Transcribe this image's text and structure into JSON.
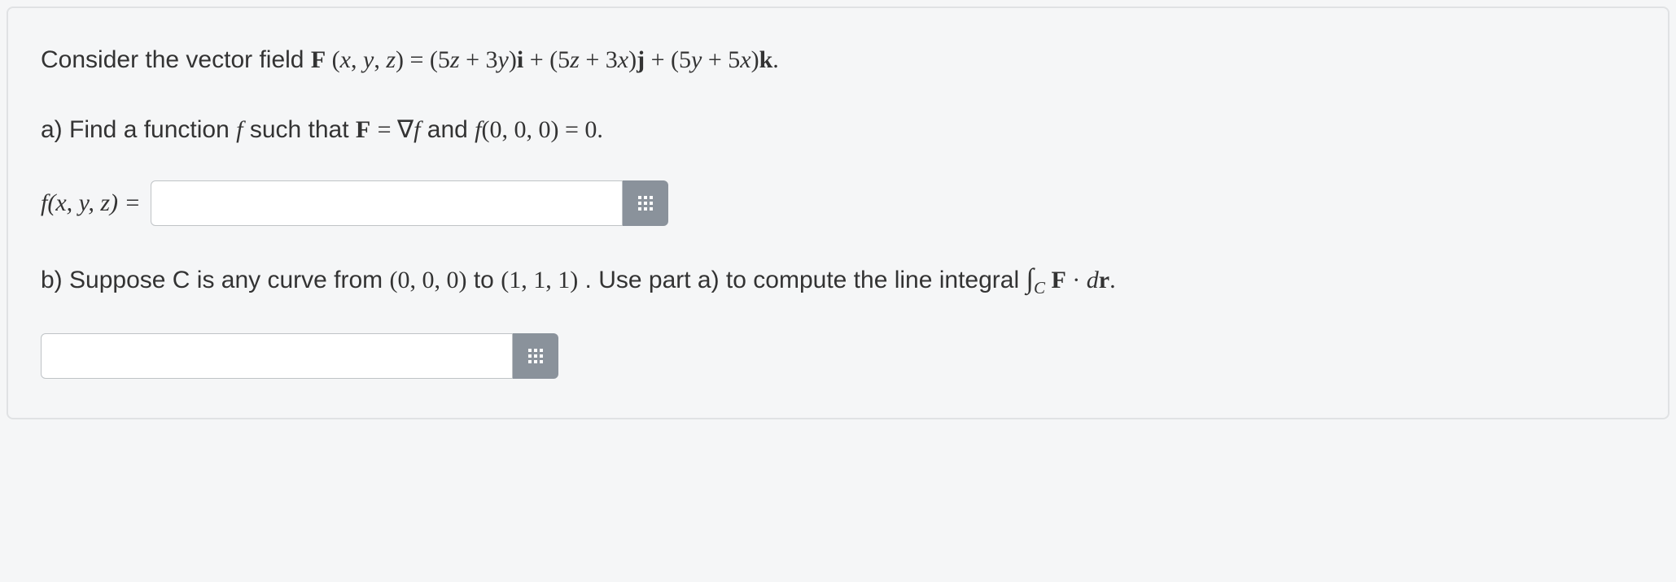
{
  "problem": {
    "intro_prefix": "Consider the vector field ",
    "F_args": "F (x, y, z) = (5z + 3y)i + (5z + 3x)j + (5y + 5x)k.",
    "part_a": {
      "prefix": "a) Find a function ",
      "f": "f",
      "mid": " such that ",
      "eq1_lhs": "F",
      "eq1_eq": " = ",
      "eq1_rhs": "∇f",
      "and": " and ",
      "eq2": "f(0, 0, 0) = 0.",
      "answer_label": "f(x, y, z) ="
    },
    "part_b": {
      "prefix": "b) Suppose C is any curve from ",
      "pt1": "(0, 0, 0)",
      "mid1": " to ",
      "pt2": "(1, 1, 1)",
      "mid2": ". Use part a) to compute the line integral ",
      "integral": "∫",
      "integral_sub": "C",
      "integrand": " F · dr."
    }
  },
  "inputs": {
    "a_value": "",
    "b_value": ""
  }
}
